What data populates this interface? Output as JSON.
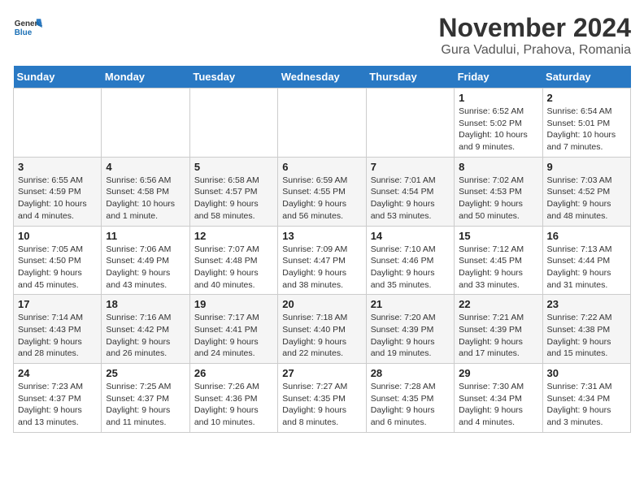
{
  "logo": {
    "general": "General",
    "blue": "Blue"
  },
  "title": "November 2024",
  "location": "Gura Vadului, Prahova, Romania",
  "days_of_week": [
    "Sunday",
    "Monday",
    "Tuesday",
    "Wednesday",
    "Thursday",
    "Friday",
    "Saturday"
  ],
  "weeks": [
    [
      {
        "day": "",
        "info": ""
      },
      {
        "day": "",
        "info": ""
      },
      {
        "day": "",
        "info": ""
      },
      {
        "day": "",
        "info": ""
      },
      {
        "day": "",
        "info": ""
      },
      {
        "day": "1",
        "info": "Sunrise: 6:52 AM\nSunset: 5:02 PM\nDaylight: 10 hours and 9 minutes."
      },
      {
        "day": "2",
        "info": "Sunrise: 6:54 AM\nSunset: 5:01 PM\nDaylight: 10 hours and 7 minutes."
      }
    ],
    [
      {
        "day": "3",
        "info": "Sunrise: 6:55 AM\nSunset: 4:59 PM\nDaylight: 10 hours and 4 minutes."
      },
      {
        "day": "4",
        "info": "Sunrise: 6:56 AM\nSunset: 4:58 PM\nDaylight: 10 hours and 1 minute."
      },
      {
        "day": "5",
        "info": "Sunrise: 6:58 AM\nSunset: 4:57 PM\nDaylight: 9 hours and 58 minutes."
      },
      {
        "day": "6",
        "info": "Sunrise: 6:59 AM\nSunset: 4:55 PM\nDaylight: 9 hours and 56 minutes."
      },
      {
        "day": "7",
        "info": "Sunrise: 7:01 AM\nSunset: 4:54 PM\nDaylight: 9 hours and 53 minutes."
      },
      {
        "day": "8",
        "info": "Sunrise: 7:02 AM\nSunset: 4:53 PM\nDaylight: 9 hours and 50 minutes."
      },
      {
        "day": "9",
        "info": "Sunrise: 7:03 AM\nSunset: 4:52 PM\nDaylight: 9 hours and 48 minutes."
      }
    ],
    [
      {
        "day": "10",
        "info": "Sunrise: 7:05 AM\nSunset: 4:50 PM\nDaylight: 9 hours and 45 minutes."
      },
      {
        "day": "11",
        "info": "Sunrise: 7:06 AM\nSunset: 4:49 PM\nDaylight: 9 hours and 43 minutes."
      },
      {
        "day": "12",
        "info": "Sunrise: 7:07 AM\nSunset: 4:48 PM\nDaylight: 9 hours and 40 minutes."
      },
      {
        "day": "13",
        "info": "Sunrise: 7:09 AM\nSunset: 4:47 PM\nDaylight: 9 hours and 38 minutes."
      },
      {
        "day": "14",
        "info": "Sunrise: 7:10 AM\nSunset: 4:46 PM\nDaylight: 9 hours and 35 minutes."
      },
      {
        "day": "15",
        "info": "Sunrise: 7:12 AM\nSunset: 4:45 PM\nDaylight: 9 hours and 33 minutes."
      },
      {
        "day": "16",
        "info": "Sunrise: 7:13 AM\nSunset: 4:44 PM\nDaylight: 9 hours and 31 minutes."
      }
    ],
    [
      {
        "day": "17",
        "info": "Sunrise: 7:14 AM\nSunset: 4:43 PM\nDaylight: 9 hours and 28 minutes."
      },
      {
        "day": "18",
        "info": "Sunrise: 7:16 AM\nSunset: 4:42 PM\nDaylight: 9 hours and 26 minutes."
      },
      {
        "day": "19",
        "info": "Sunrise: 7:17 AM\nSunset: 4:41 PM\nDaylight: 9 hours and 24 minutes."
      },
      {
        "day": "20",
        "info": "Sunrise: 7:18 AM\nSunset: 4:40 PM\nDaylight: 9 hours and 22 minutes."
      },
      {
        "day": "21",
        "info": "Sunrise: 7:20 AM\nSunset: 4:39 PM\nDaylight: 9 hours and 19 minutes."
      },
      {
        "day": "22",
        "info": "Sunrise: 7:21 AM\nSunset: 4:39 PM\nDaylight: 9 hours and 17 minutes."
      },
      {
        "day": "23",
        "info": "Sunrise: 7:22 AM\nSunset: 4:38 PM\nDaylight: 9 hours and 15 minutes."
      }
    ],
    [
      {
        "day": "24",
        "info": "Sunrise: 7:23 AM\nSunset: 4:37 PM\nDaylight: 9 hours and 13 minutes."
      },
      {
        "day": "25",
        "info": "Sunrise: 7:25 AM\nSunset: 4:37 PM\nDaylight: 9 hours and 11 minutes."
      },
      {
        "day": "26",
        "info": "Sunrise: 7:26 AM\nSunset: 4:36 PM\nDaylight: 9 hours and 10 minutes."
      },
      {
        "day": "27",
        "info": "Sunrise: 7:27 AM\nSunset: 4:35 PM\nDaylight: 9 hours and 8 minutes."
      },
      {
        "day": "28",
        "info": "Sunrise: 7:28 AM\nSunset: 4:35 PM\nDaylight: 9 hours and 6 minutes."
      },
      {
        "day": "29",
        "info": "Sunrise: 7:30 AM\nSunset: 4:34 PM\nDaylight: 9 hours and 4 minutes."
      },
      {
        "day": "30",
        "info": "Sunrise: 7:31 AM\nSunset: 4:34 PM\nDaylight: 9 hours and 3 minutes."
      }
    ]
  ]
}
